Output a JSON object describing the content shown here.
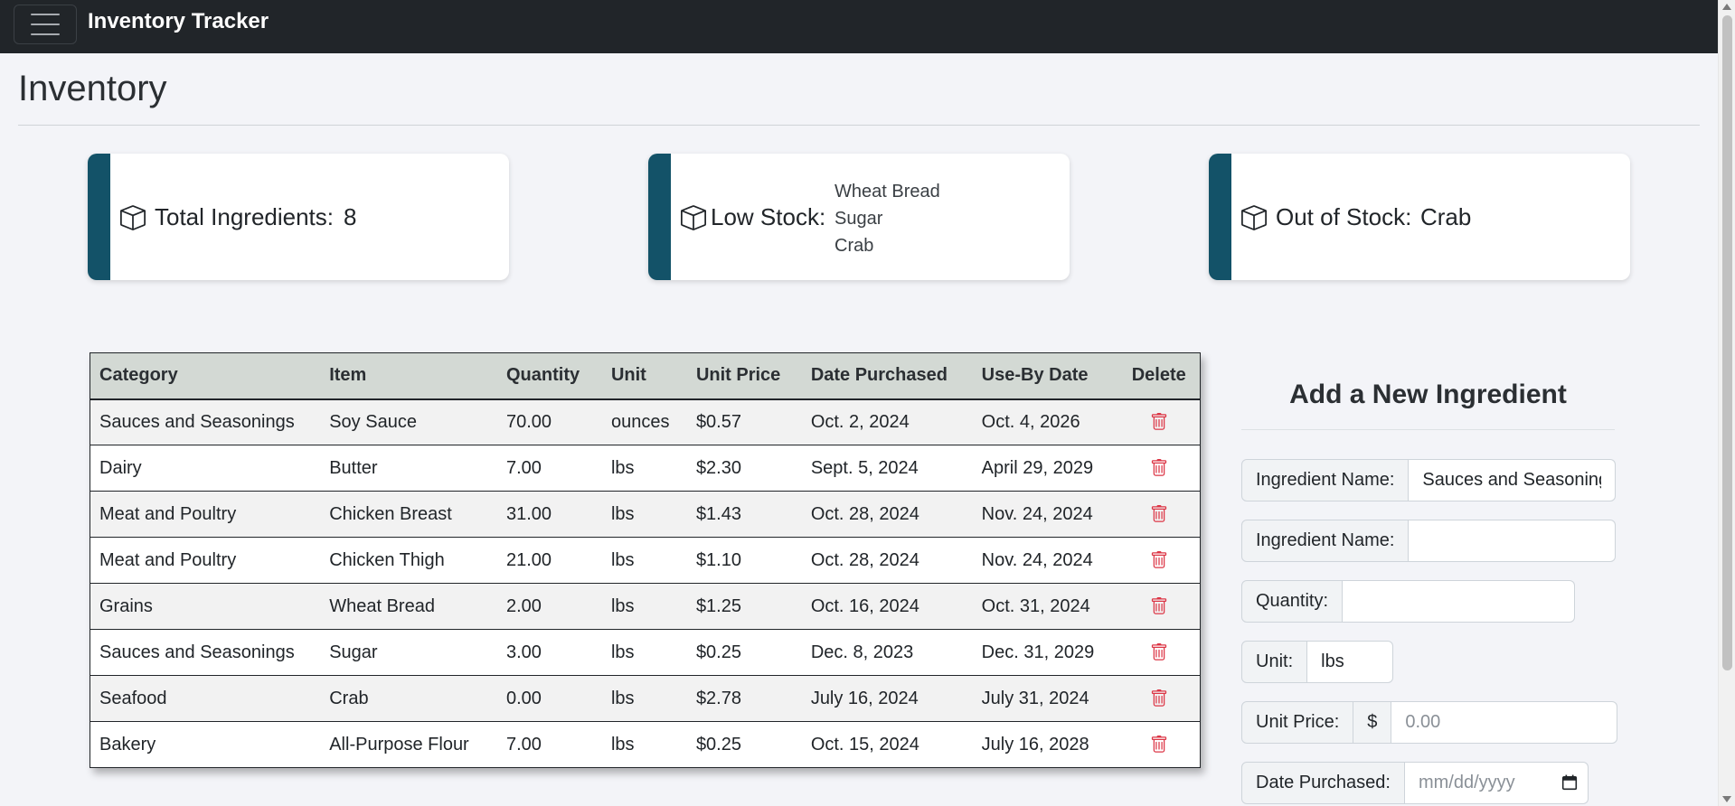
{
  "app": {
    "title": "Inventory Tracker"
  },
  "page": {
    "title": "Inventory"
  },
  "stats": {
    "total": {
      "label": "Total Ingredients:",
      "value": "8"
    },
    "low": {
      "label": "Low Stock:",
      "items": [
        "Wheat Bread",
        "Sugar",
        "Crab"
      ]
    },
    "out": {
      "label": "Out of Stock:",
      "value": "Crab"
    }
  },
  "table": {
    "headers": [
      "Category",
      "Item",
      "Quantity",
      "Unit",
      "Unit Price",
      "Date Purchased",
      "Use-By Date",
      "Delete"
    ],
    "rows": [
      [
        "Sauces and Seasonings",
        "Soy Sauce",
        "70.00",
        "ounces",
        "$0.57",
        "Oct. 2, 2024",
        "Oct. 4, 2026"
      ],
      [
        "Dairy",
        "Butter",
        "7.00",
        "lbs",
        "$2.30",
        "Sept. 5, 2024",
        "April 29, 2029"
      ],
      [
        "Meat and Poultry",
        "Chicken Breast",
        "31.00",
        "lbs",
        "$1.43",
        "Oct. 28, 2024",
        "Nov. 24, 2024"
      ],
      [
        "Meat and Poultry",
        "Chicken Thigh",
        "21.00",
        "lbs",
        "$1.10",
        "Oct. 28, 2024",
        "Nov. 24, 2024"
      ],
      [
        "Grains",
        "Wheat Bread",
        "2.00",
        "lbs",
        "$1.25",
        "Oct. 16, 2024",
        "Oct. 31, 2024"
      ],
      [
        "Sauces and Seasonings",
        "Sugar",
        "3.00",
        "lbs",
        "$0.25",
        "Dec. 8, 2023",
        "Dec. 31, 2029"
      ],
      [
        "Seafood",
        "Crab",
        "0.00",
        "lbs",
        "$2.78",
        "July 16, 2024",
        "July 31, 2024"
      ],
      [
        "Bakery",
        "All-Purpose Flour",
        "7.00",
        "lbs",
        "$0.25",
        "Oct. 15, 2024",
        "July 16, 2028"
      ]
    ]
  },
  "form": {
    "title": "Add a New Ingredient",
    "category_label": "Ingredient Name:",
    "category_value": "Sauces and Seasoning",
    "name_label": "Ingredient Name:",
    "name_value": "",
    "quantity_label": "Quantity:",
    "quantity_value": "",
    "unit_label": "Unit:",
    "unit_value": "lbs",
    "price_label": "Unit Price:",
    "price_prefix": "$",
    "price_placeholder": "0.00",
    "date_label": "Date Purchased:",
    "date_placeholder": "mm/dd/yyyy"
  },
  "icons": {
    "menu": "hamburger-icon",
    "stat": "box-icon",
    "delete": "trash-icon",
    "date": "calendar-icon"
  },
  "colors": {
    "navbar": "#212529",
    "accent": "#135268",
    "delete": "#dc3545",
    "table_header": "#d3d9d4"
  }
}
